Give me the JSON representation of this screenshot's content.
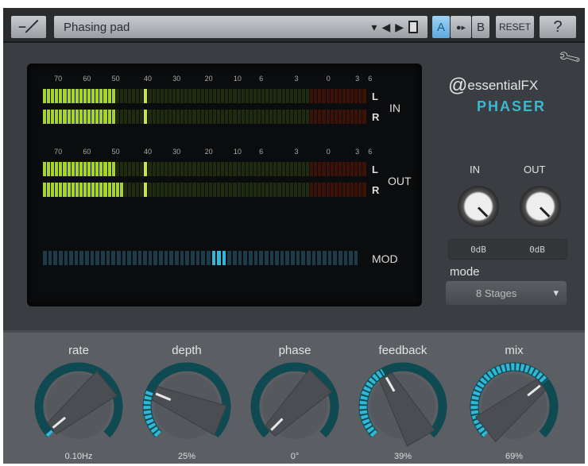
{
  "topbar": {
    "bypass_icon": "curve-icon",
    "preset_name": "Phasing pad",
    "dropdown_icon": "▾",
    "prev_icon": "◀",
    "next_icon": "▶",
    "save_icon": "floppy-disk-icon",
    "a_label": "A",
    "copy_label": "●▸",
    "b_label": "B",
    "reset_label": "RESET",
    "help_label": "?"
  },
  "display": {
    "scale": [
      "70",
      "60",
      "50",
      "40",
      "30",
      "20",
      "10",
      "6",
      "3",
      "0",
      "3",
      "6"
    ],
    "in": {
      "label": "IN",
      "L": "L",
      "R": "R",
      "levels": [
        0.22,
        0.22
      ],
      "peaks": [
        0.31,
        0.31
      ]
    },
    "out": {
      "label": "OUT",
      "L": "L",
      "R": "R",
      "levels": [
        0.22,
        0.245
      ],
      "peaks": [
        0.31,
        0.31
      ]
    },
    "mod": {
      "label": "MOD",
      "position": 0.55
    }
  },
  "side": {
    "brand": "essentialFX",
    "product": "PHASER",
    "in_label": "IN",
    "out_label": "OUT",
    "in_value": "0dB",
    "out_value": "0dB",
    "mode_label": "mode",
    "mode_value": "8 Stages",
    "mode_arrow": "▾",
    "settings_icon": "wrench-icon"
  },
  "knobs": [
    {
      "label": "rate",
      "value": "0.10Hz",
      "fraction": 0.02
    },
    {
      "label": "depth",
      "value": "25%",
      "fraction": 0.25
    },
    {
      "label": "phase",
      "value": "0°",
      "fraction": 0.0
    },
    {
      "label": "feedback",
      "value": "39%",
      "fraction": 0.39
    },
    {
      "label": "mix",
      "value": "69%",
      "fraction": 0.69
    }
  ],
  "colors": {
    "accent": "#2fb8d8",
    "meter_green": "#a6d42a",
    "meter_red": "#3a1208",
    "track": "#0f4a52"
  }
}
